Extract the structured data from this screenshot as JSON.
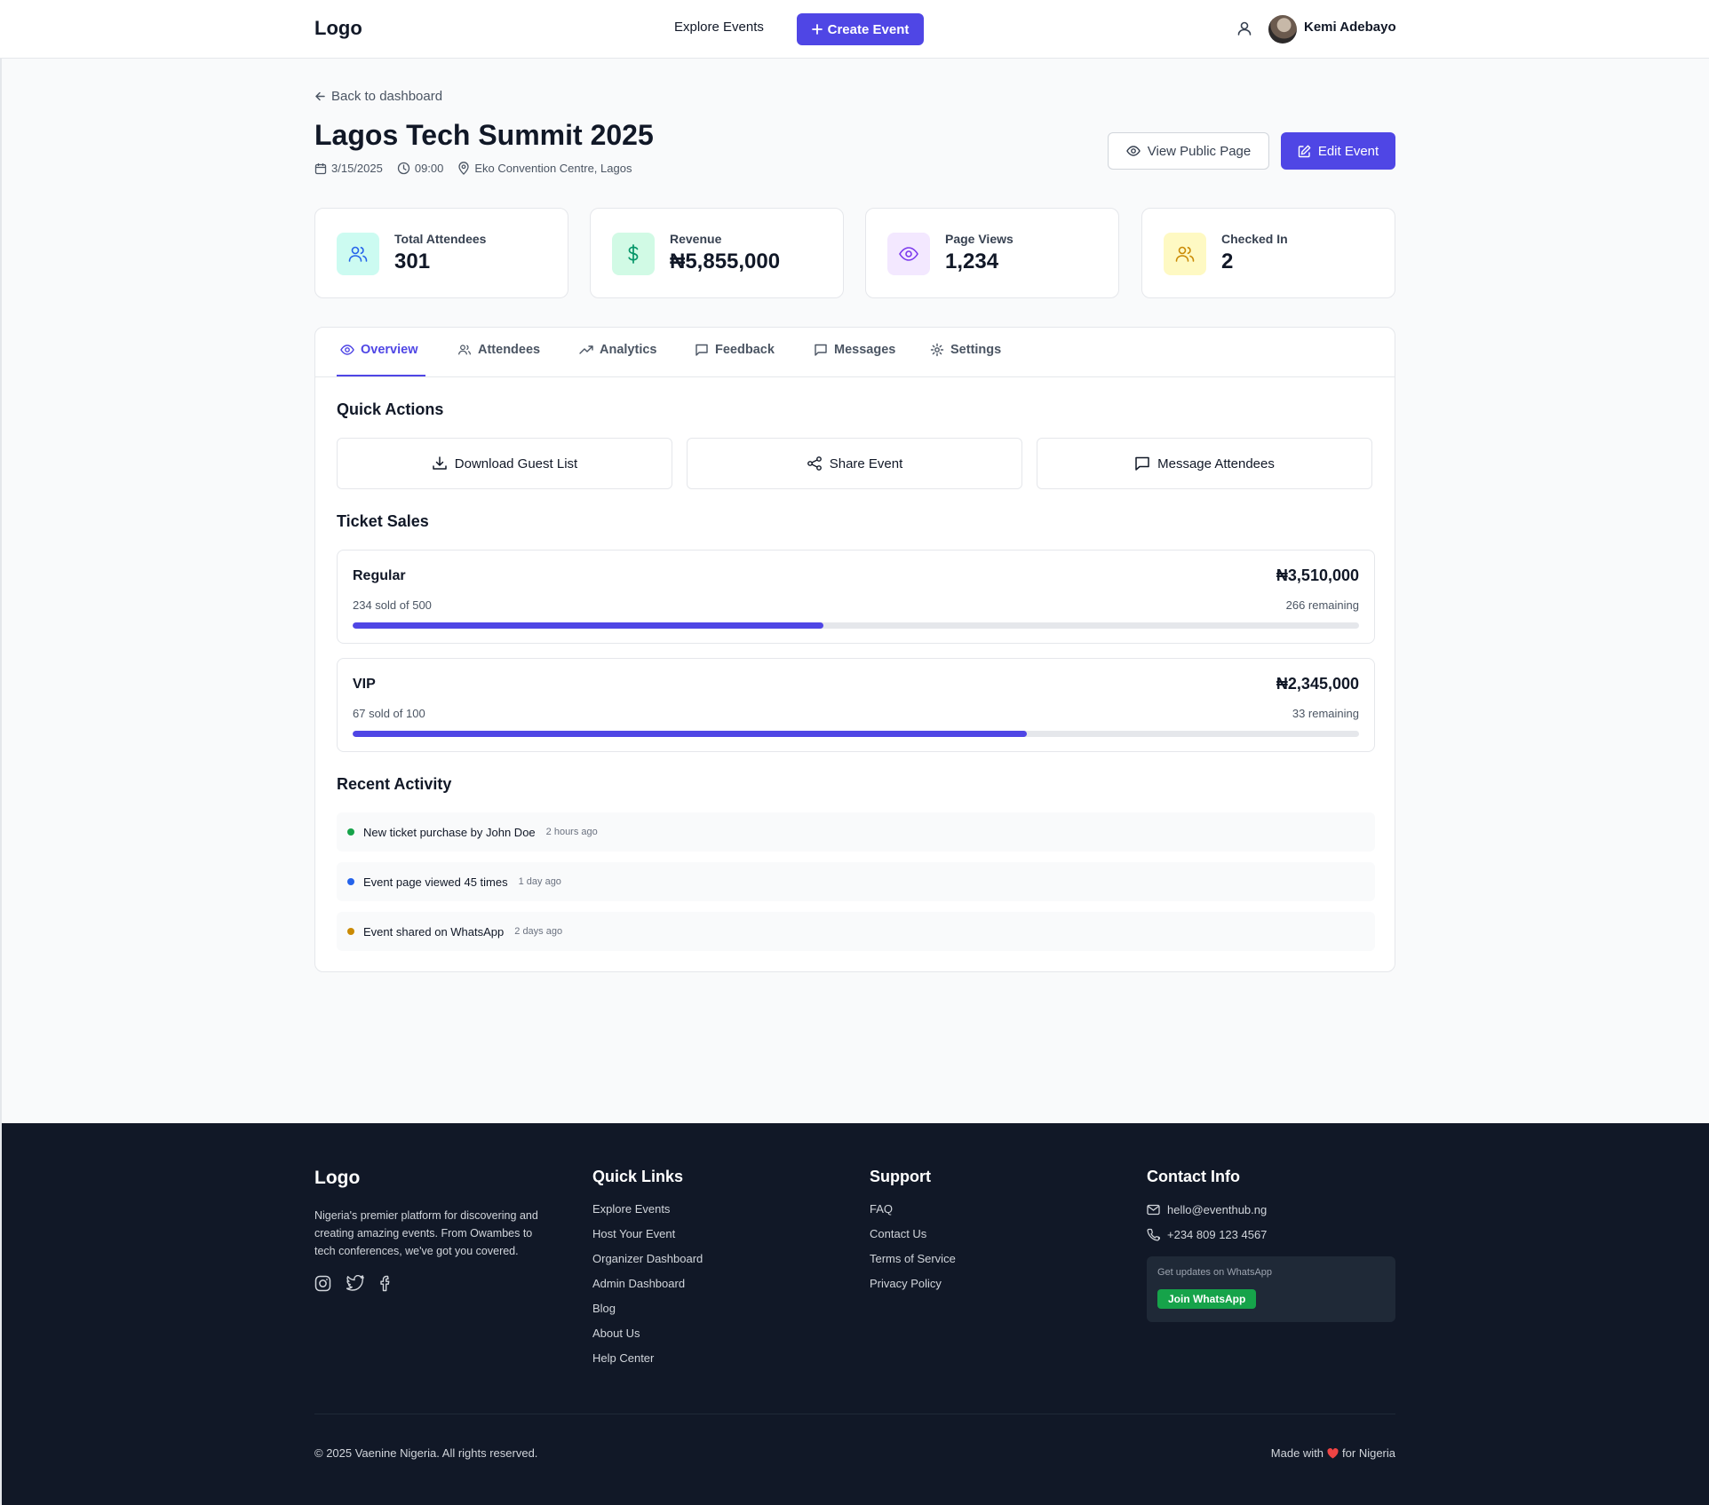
{
  "header": {
    "logo": "Logo",
    "explore_label": "Explore Events",
    "create_label": "Create Event",
    "user_name": "Kemi Adebayo"
  },
  "event": {
    "back_label": "Back to dashboard",
    "title": "Lagos Tech Summit 2025",
    "date": "3/15/2025",
    "time": "09:00",
    "location": "Eko Convention Centre, Lagos",
    "view_public_label": "View Public Page",
    "edit_label": "Edit Event"
  },
  "stats": [
    {
      "label": "Total Attendees",
      "value": "301",
      "icon": "users-icon",
      "color": "#0d9488",
      "bg": "#ccfbf1"
    },
    {
      "label": "Revenue",
      "value": "₦5,855,000",
      "icon": "dollar-icon",
      "color": "#16a34a",
      "bg": "#dcfce7"
    },
    {
      "label": "Page Views",
      "value": "1,234",
      "icon": "eye-icon",
      "color": "#7c3aed",
      "bg": "#f3e8ff"
    },
    {
      "label": "Checked In",
      "value": "2",
      "icon": "users-icon",
      "color": "#ca8a04",
      "bg": "#fef9c3"
    }
  ],
  "tabs": [
    {
      "label": "Overview",
      "icon": "eye-icon",
      "active": true
    },
    {
      "label": "Attendees",
      "icon": "users-icon"
    },
    {
      "label": "Analytics",
      "icon": "trending-up-icon"
    },
    {
      "label": "Feedback",
      "icon": "message-square-icon"
    },
    {
      "label": "Messages",
      "icon": "message-square-icon"
    },
    {
      "label": "Settings",
      "icon": "gear-icon"
    }
  ],
  "quick_actions": {
    "title": "Quick Actions",
    "items": [
      {
        "label": "Download Guest List",
        "icon": "download-icon"
      },
      {
        "label": "Share Event",
        "icon": "share-icon"
      },
      {
        "label": "Message Attendees",
        "icon": "message-square-icon"
      }
    ]
  },
  "ticket_sales": {
    "title": "Ticket Sales",
    "items": [
      {
        "name": "Regular",
        "amount": "₦3,510,000",
        "sold": "234 sold of 500",
        "remaining": "266 remaining",
        "fraction": 0.468
      },
      {
        "name": "VIP",
        "amount": "₦2,345,000",
        "sold": "67 sold of 100",
        "remaining": "33 remaining",
        "fraction": 0.67
      }
    ]
  },
  "recent_activity": {
    "title": "Recent Activity",
    "items": [
      {
        "text": "New ticket purchase by John Doe",
        "time": "2 hours ago",
        "color": "#16a34a"
      },
      {
        "text": "Event page viewed 45 times",
        "time": "1 day ago",
        "color": "#2563eb"
      },
      {
        "text": "Event shared on WhatsApp",
        "time": "2 days ago",
        "color": "#ca8a04"
      }
    ]
  },
  "footer": {
    "logo": "Logo",
    "description": "Nigeria's premier platform for discovering and creating amazing events. From Owambes to tech conferences, we've got you covered.",
    "quick_links_title": "Quick Links",
    "quick_links": [
      "Explore Events",
      "Host Your Event",
      "Organizer Dashboard",
      "Admin Dashboard",
      "Blog",
      "About Us",
      "Help Center"
    ],
    "support_title": "Support",
    "support_links": [
      "FAQ",
      "Contact Us",
      "Terms of Service",
      "Privacy Policy"
    ],
    "contact_title": "Contact Info",
    "email": "hello@eventhub.ng",
    "phone": "+234 809 123 4567",
    "whatsapp_text": "Get updates on WhatsApp",
    "whatsapp_button": "Join WhatsApp",
    "copyright": "© 2025 Vaenine Nigeria. All rights reserved.",
    "made_with_prefix": "Made with",
    "made_with_suffix": "for Nigeria"
  }
}
